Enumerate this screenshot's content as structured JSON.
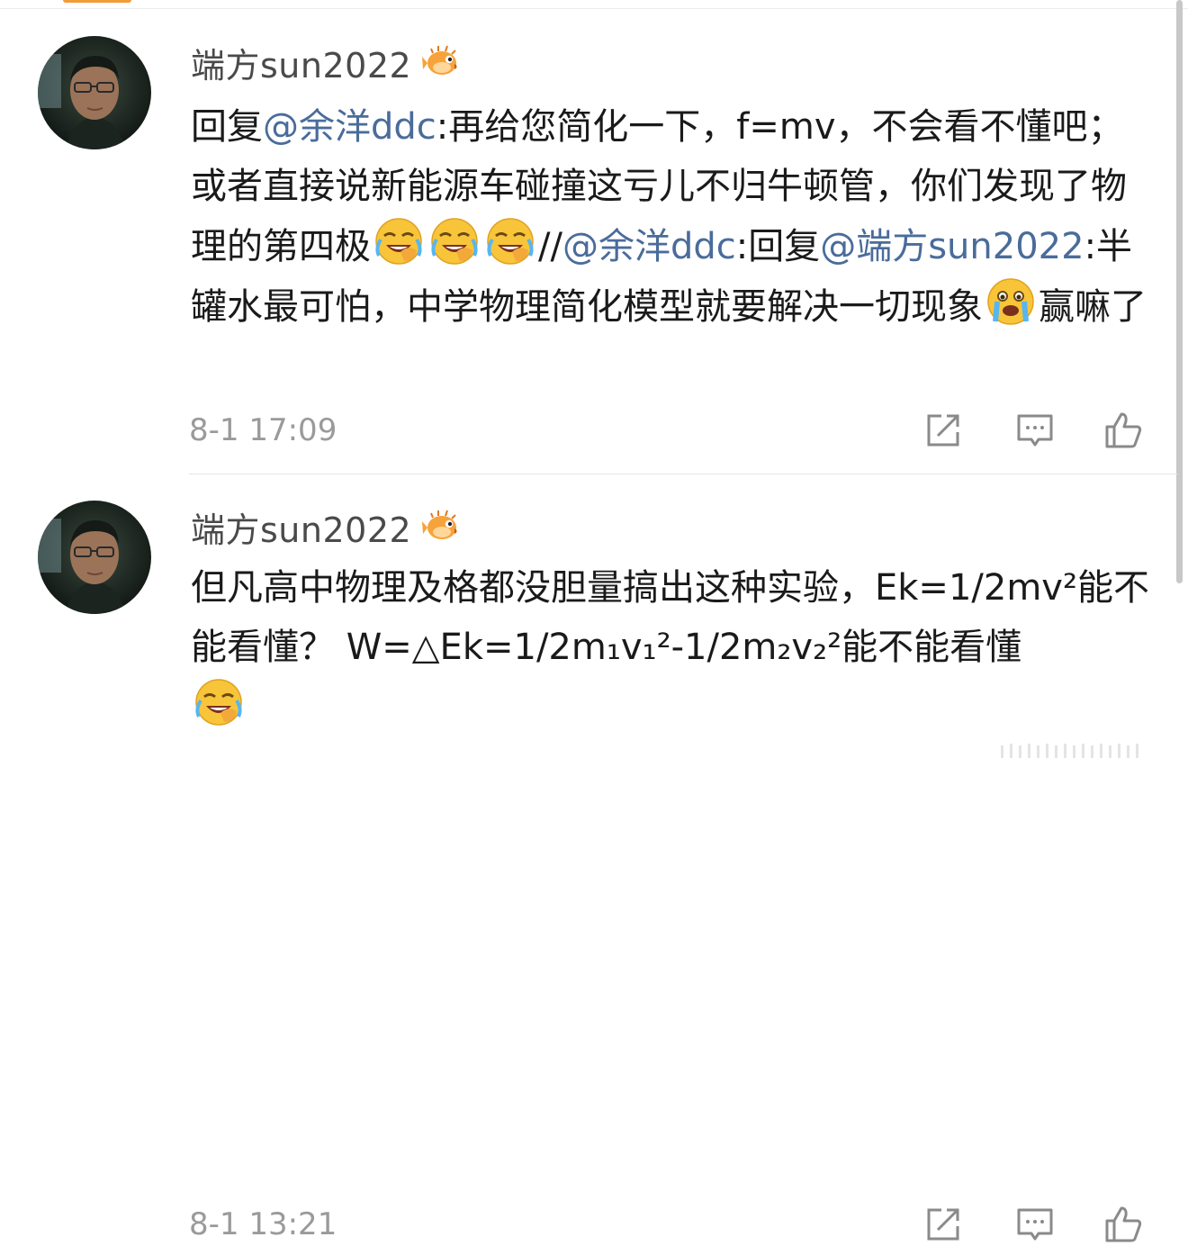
{
  "comments": [
    {
      "username": "端方sun2022",
      "segments": [
        {
          "type": "text",
          "value": "回复"
        },
        {
          "type": "mention",
          "value": "@余洋ddc"
        },
        {
          "type": "text",
          "value": ":再给您简化一下，f=mv，不会看不懂吧；  或者直接说新能源车碰撞这亏儿不归牛顿管，你们发现了物理的第四极"
        },
        {
          "type": "emoji",
          "icon": "laugh-cry-emoji"
        },
        {
          "type": "emoji",
          "icon": "laugh-cry-emoji"
        },
        {
          "type": "emoji",
          "icon": "laugh-cry-emoji"
        },
        {
          "type": "text",
          "value": "//"
        },
        {
          "type": "mention",
          "value": "@余洋ddc"
        },
        {
          "type": "text",
          "value": ":回复"
        },
        {
          "type": "mention",
          "value": "@端方sun2022"
        },
        {
          "type": "text",
          "value": ":半罐水最可怕，中学物理简化模型就要解决一切现象"
        },
        {
          "type": "emoji",
          "icon": "crying-emoji"
        },
        {
          "type": "text",
          "value": "赢嘛了"
        }
      ],
      "timestamp": "8-1 17:09"
    },
    {
      "username": "端方sun2022",
      "segments": [
        {
          "type": "text",
          "value": "但凡高中物理及格都没胆量搞出这种实验，Ek=1/2mv²能不能看懂？  W=△Ek=1/2m₁v₁²-1/2m₂v₂²能不能看懂"
        },
        {
          "type": "emoji",
          "icon": "laugh-cry-emoji"
        }
      ],
      "timestamp": "8-1 13:21"
    }
  ],
  "colors": {
    "mention": "#4a6c9b",
    "username": "#4a4a4a",
    "timestamp": "#9a9a9a",
    "icon_stroke": "#8a8a8a",
    "top_tab": "#f29b37"
  },
  "icons": {
    "badge": "pufferfish-badge-icon",
    "share": "share-icon",
    "comment": "comment-icon",
    "like": "thumbs-up-icon"
  }
}
